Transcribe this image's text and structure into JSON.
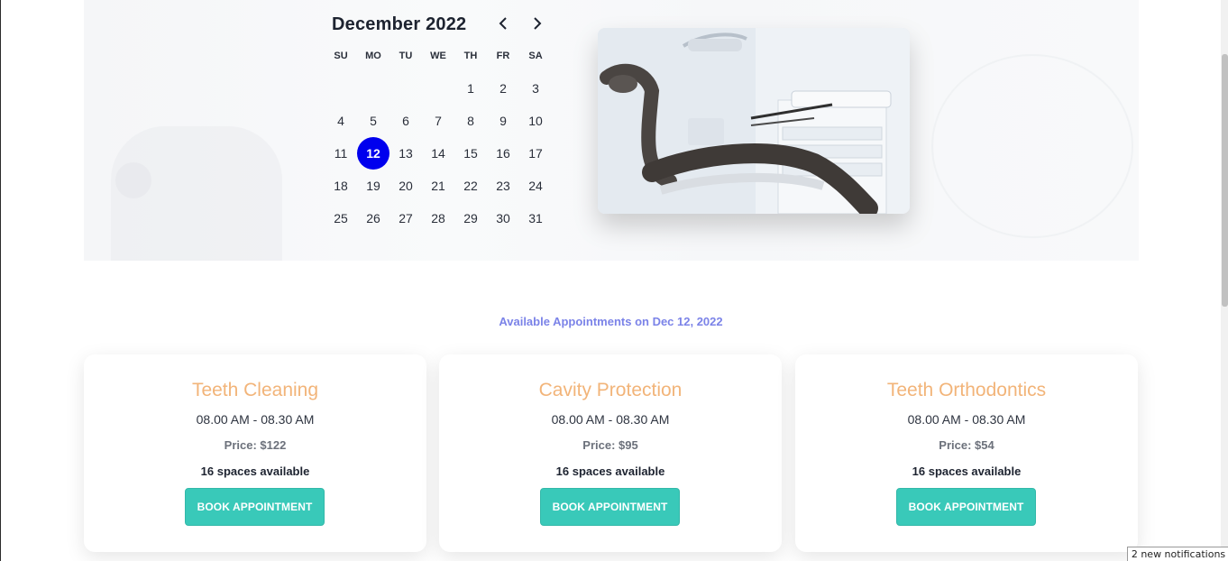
{
  "calendar": {
    "month_label": "December 2022",
    "weekdays": [
      "SU",
      "MO",
      "TU",
      "WE",
      "TH",
      "FR",
      "SA"
    ],
    "leading_blanks": 4,
    "days": [
      "1",
      "2",
      "3",
      "4",
      "5",
      "6",
      "7",
      "8",
      "9",
      "10",
      "11",
      "12",
      "13",
      "14",
      "15",
      "16",
      "17",
      "18",
      "19",
      "20",
      "21",
      "22",
      "23",
      "24",
      "25",
      "26",
      "27",
      "28",
      "29",
      "30",
      "31"
    ],
    "selected_day": "12",
    "prev_icon": "chevron-left-icon",
    "next_icon": "chevron-right-icon",
    "selected_color": "#0000ee"
  },
  "photo": {
    "subject": "dental-chair-photo"
  },
  "appointments": {
    "heading": "Available Appointments on Dec 12, 2022",
    "cards": [
      {
        "title": "Teeth Cleaning",
        "time": "08.00 AM - 08.30 AM",
        "price": "Price: $122",
        "spaces": "16 spaces available",
        "button": "BOOK APPOINTMENT"
      },
      {
        "title": "Cavity Protection",
        "time": "08.00 AM - 08.30 AM",
        "price": "Price: $95",
        "spaces": "16 spaces available",
        "button": "BOOK APPOINTMENT"
      },
      {
        "title": "Teeth Orthodontics",
        "time": "08.00 AM - 08.30 AM",
        "price": "Price: $54",
        "spaces": "16 spaces available",
        "button": "BOOK APPOINTMENT"
      }
    ]
  },
  "colors": {
    "accent": "#39c9b9",
    "title": "#f2b479",
    "heading": "#7b83e8"
  },
  "notification": {
    "text": "2 new notifications"
  }
}
